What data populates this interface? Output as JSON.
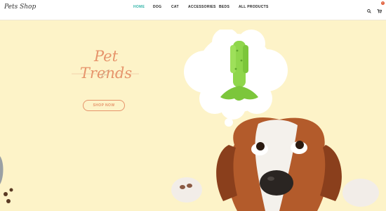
{
  "header": {
    "logo_text": "Pets Shop",
    "nav": [
      {
        "label": "HOME",
        "active": true
      },
      {
        "label": "DOG"
      },
      {
        "label": "CAT"
      },
      {
        "label": "ACCESSORIES"
      },
      {
        "label": "BEDS"
      },
      {
        "label": "ALL PRODUCTS"
      }
    ],
    "cart_count": "0",
    "search_icon": "search-icon",
    "cart_icon": "cart-icon"
  },
  "hero": {
    "title": "Pet Trends",
    "button_label": "SHOP NOW"
  },
  "colors": {
    "accent": "#e6936a",
    "nav_active": "#2fb3a7",
    "background": "#fdf3c8"
  }
}
